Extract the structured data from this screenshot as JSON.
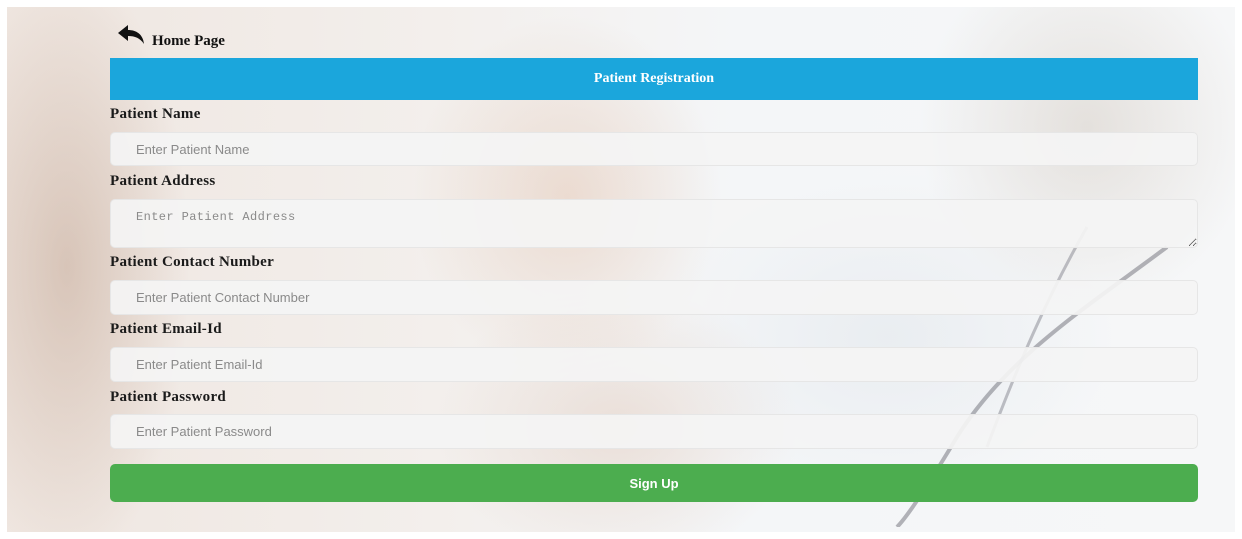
{
  "nav": {
    "back_label": "Home Page"
  },
  "header": {
    "title": "Patient Registration"
  },
  "form": {
    "name": {
      "label": "Patient Name",
      "placeholder": "Enter Patient Name",
      "value": ""
    },
    "address": {
      "label": "Patient Address",
      "placeholder": "Enter Patient Address",
      "value": ""
    },
    "contact": {
      "label": "Patient Contact Number",
      "placeholder": "Enter Patient Contact Number",
      "value": ""
    },
    "email": {
      "label": "Patient Email-Id",
      "placeholder": "Enter Patient Email-Id",
      "value": ""
    },
    "password": {
      "label": "Patient Password",
      "placeholder": "Enter Patient Password",
      "value": ""
    },
    "submit_label": "Sign Up"
  },
  "icons": {
    "back": "back-arrow-icon"
  },
  "colors": {
    "header": "#1ba6dc",
    "button": "#4cad4f"
  }
}
